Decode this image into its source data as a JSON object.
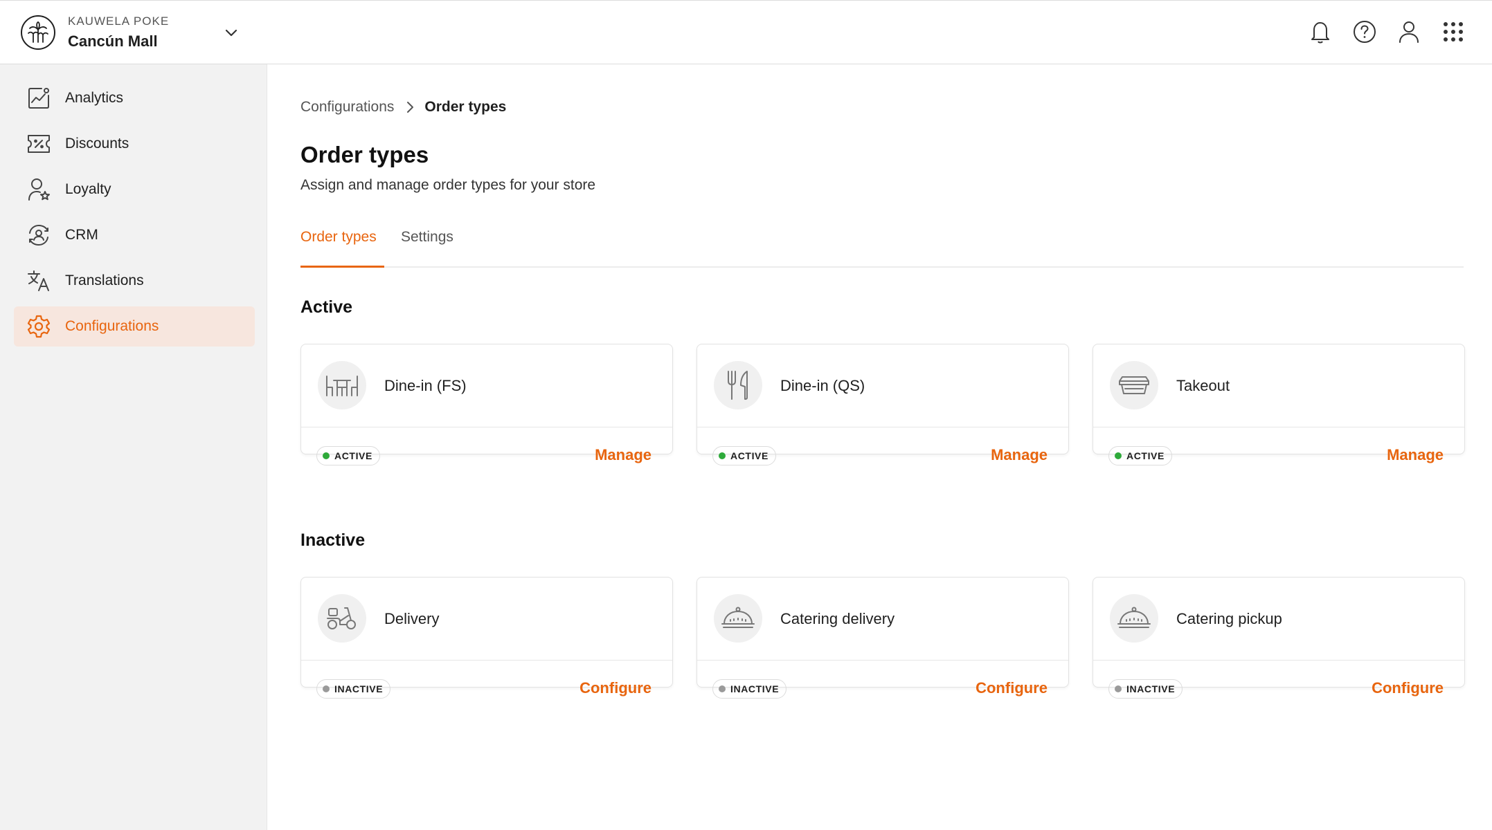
{
  "colors": {
    "accent": "#e8650f",
    "active_dot": "#2eaa3a",
    "inactive_dot": "#9a9a9a",
    "active_nav_bg": "#f7e6de"
  },
  "header": {
    "org_name": "KAUWELA POKE",
    "store_name": "Cancún Mall",
    "icons": [
      "bell-icon",
      "help-icon",
      "user-icon",
      "apps-grid-icon"
    ]
  },
  "sidebar": {
    "items": [
      {
        "label": "Analytics",
        "icon": "analytics-icon"
      },
      {
        "label": "Discounts",
        "icon": "discount-ticket-icon"
      },
      {
        "label": "Loyalty",
        "icon": "loyalty-user-star-icon"
      },
      {
        "label": "CRM",
        "icon": "crm-icon"
      },
      {
        "label": "Translations",
        "icon": "translate-icon"
      },
      {
        "label": "Configurations",
        "icon": "gear-icon",
        "active": true
      }
    ]
  },
  "breadcrumb": {
    "parent": "Configurations",
    "current": "Order types"
  },
  "page": {
    "title": "Order types",
    "subtitle": "Assign and manage order types for your store"
  },
  "tabs": [
    {
      "label": "Order types",
      "active": true
    },
    {
      "label": "Settings",
      "active": false
    }
  ],
  "sections": {
    "active": {
      "title": "Active",
      "cards": [
        {
          "name": "Dine-in (FS)",
          "icon": "table-icon",
          "status": "ACTIVE",
          "action": "Manage"
        },
        {
          "name": "Dine-in (QS)",
          "icon": "fork-knife-icon",
          "status": "ACTIVE",
          "action": "Manage"
        },
        {
          "name": "Takeout",
          "icon": "takeout-box-icon",
          "status": "ACTIVE",
          "action": "Manage"
        }
      ]
    },
    "inactive": {
      "title": "Inactive",
      "cards": [
        {
          "name": "Delivery",
          "icon": "scooter-icon",
          "status": "INACTIVE",
          "action": "Configure"
        },
        {
          "name": "Catering delivery",
          "icon": "cloche-icon",
          "status": "INACTIVE",
          "action": "Configure"
        },
        {
          "name": "Catering pickup",
          "icon": "cloche-icon",
          "status": "INACTIVE",
          "action": "Configure"
        }
      ]
    }
  }
}
